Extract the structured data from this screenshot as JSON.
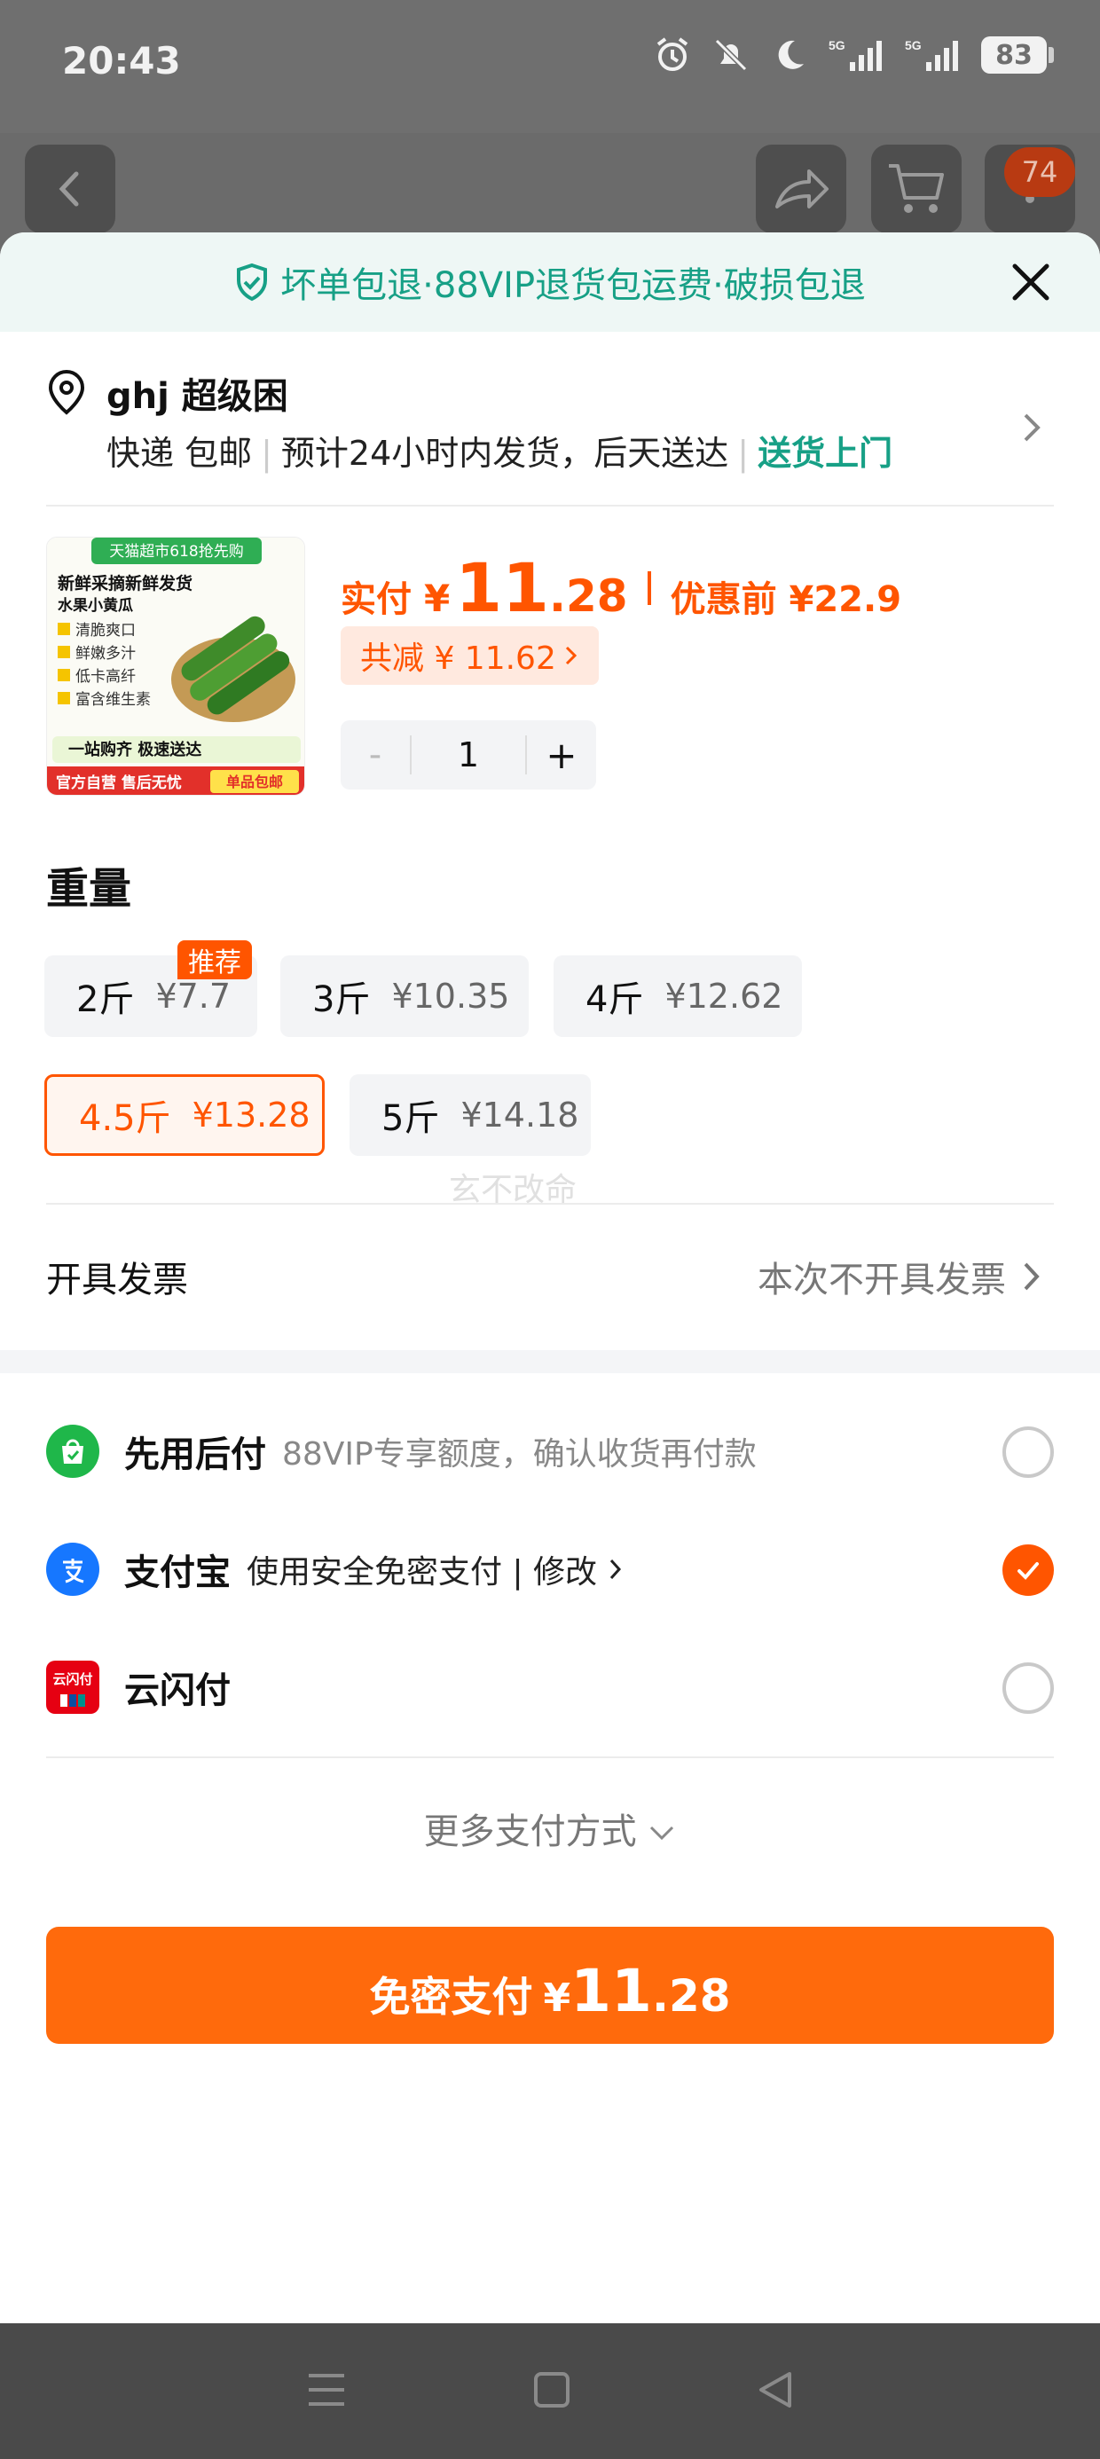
{
  "status_bar": {
    "time": "20:43",
    "battery": "83",
    "signal_1": "5G",
    "signal_2": "5G"
  },
  "header": {
    "cart_badge": "74"
  },
  "guarantee_banner": {
    "text": "坏单包退·88VIP退货包运费·破损包退"
  },
  "address": {
    "name": "ghj 超级困",
    "shipping": "快递 包邮",
    "eta": "预计24小时内发货，后天送达",
    "delivery": "送货上门"
  },
  "product": {
    "image_lines": [
      "天猫超市618抢先购",
      "新鲜采摘新鲜发货",
      "水果小黄瓜",
      "清脆爽口",
      "鲜嫩多汁",
      "低卡高纤",
      "富含维生素",
      "一站购齐 极速送达",
      "官方自营 售后无忧",
      "单品包邮"
    ],
    "pay_label": "实付",
    "currency": "¥",
    "price_int": "11",
    "price_dec": ".28",
    "original": "优惠前 ¥22.9",
    "discount": "共减 ¥ 11.62",
    "quantity": "1",
    "minus": "-",
    "plus": "+"
  },
  "weight": {
    "title": "重量",
    "recommend_badge": "推荐",
    "options": [
      {
        "label": "2斤",
        "price": "¥7.7"
      },
      {
        "label": "3斤",
        "price": "¥10.35"
      },
      {
        "label": "4斤",
        "price": "¥12.62"
      },
      {
        "label": "4.5斤",
        "price": "¥13.28",
        "selected": true
      },
      {
        "label": "5斤",
        "price": "¥14.18"
      }
    ]
  },
  "watermark": "玄不改命",
  "invoice": {
    "label": "开具发票",
    "value": "本次不开具发票"
  },
  "payment_methods": [
    {
      "name": "先用后付",
      "desc": "88VIP专享额度，确认收货再付款",
      "selected": false,
      "color": "#1fb74a"
    },
    {
      "name": "支付宝",
      "desc": "使用安全免密支付 | 修改",
      "selected": true,
      "color": "#1677ff"
    },
    {
      "name": "云闪付",
      "desc": "",
      "selected": false,
      "color": "#e60012"
    }
  ],
  "unionpay_icon_text": "云闪付",
  "more_payments": "更多支付方式",
  "pay_button": {
    "text": "免密支付",
    "currency": "¥",
    "int": "11",
    "dec": ".28"
  },
  "colors": {
    "accent": "#ff5500",
    "green": "#17a086"
  }
}
